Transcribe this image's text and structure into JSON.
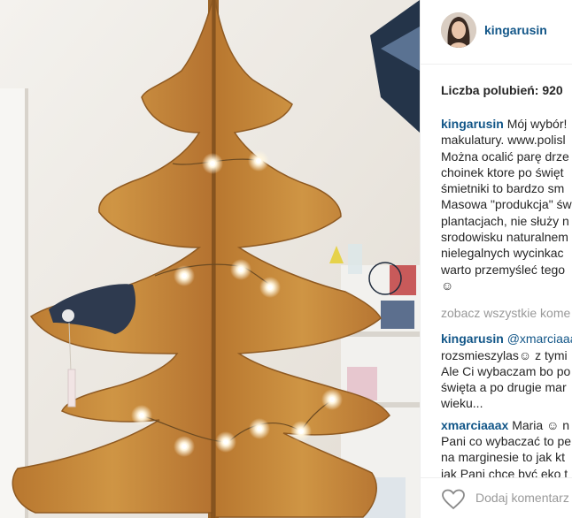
{
  "post": {
    "username": "kingarusin",
    "likes_label": "Liczba polubień: 920"
  },
  "caption": {
    "user": "kingarusin",
    "lines": [
      "Mój wybór!",
      "makulatury. www.polisl",
      "Można ocalić parę drze",
      "choinek ktore po święt",
      "śmietniki to bardzo sm",
      "Masowa \"produkcja\" św",
      "plantacjach, nie służy n",
      "srodowisku naturalnem",
      "nielegalnych wycinkac",
      "warto przemyśleć tego",
      "☺"
    ]
  },
  "view_all": "zobacz wszystkie kome",
  "comments": [
    {
      "user": "kingarusin",
      "mention": "@xmarciaaa",
      "lines": [
        "rozsmieszylas☺ z tymi",
        "Ale Ci wybaczam bo po",
        "święta a po drugie mar",
        "wieku..."
      ]
    },
    {
      "user": "xmarciaaax",
      "first": "Maria ☺ n",
      "lines": [
        "Pani co wybaczać to pe",
        "na marginesie to jak kt",
        "jak Pani chce być eko t"
      ]
    }
  ],
  "footer": {
    "add_comment_placeholder": "Dodaj komentarz"
  },
  "icons": {
    "like": "heart-outline-icon"
  },
  "colors": {
    "link": "#125688",
    "text": "#262626",
    "muted": "#999999",
    "cardboard": "#c4893f"
  }
}
